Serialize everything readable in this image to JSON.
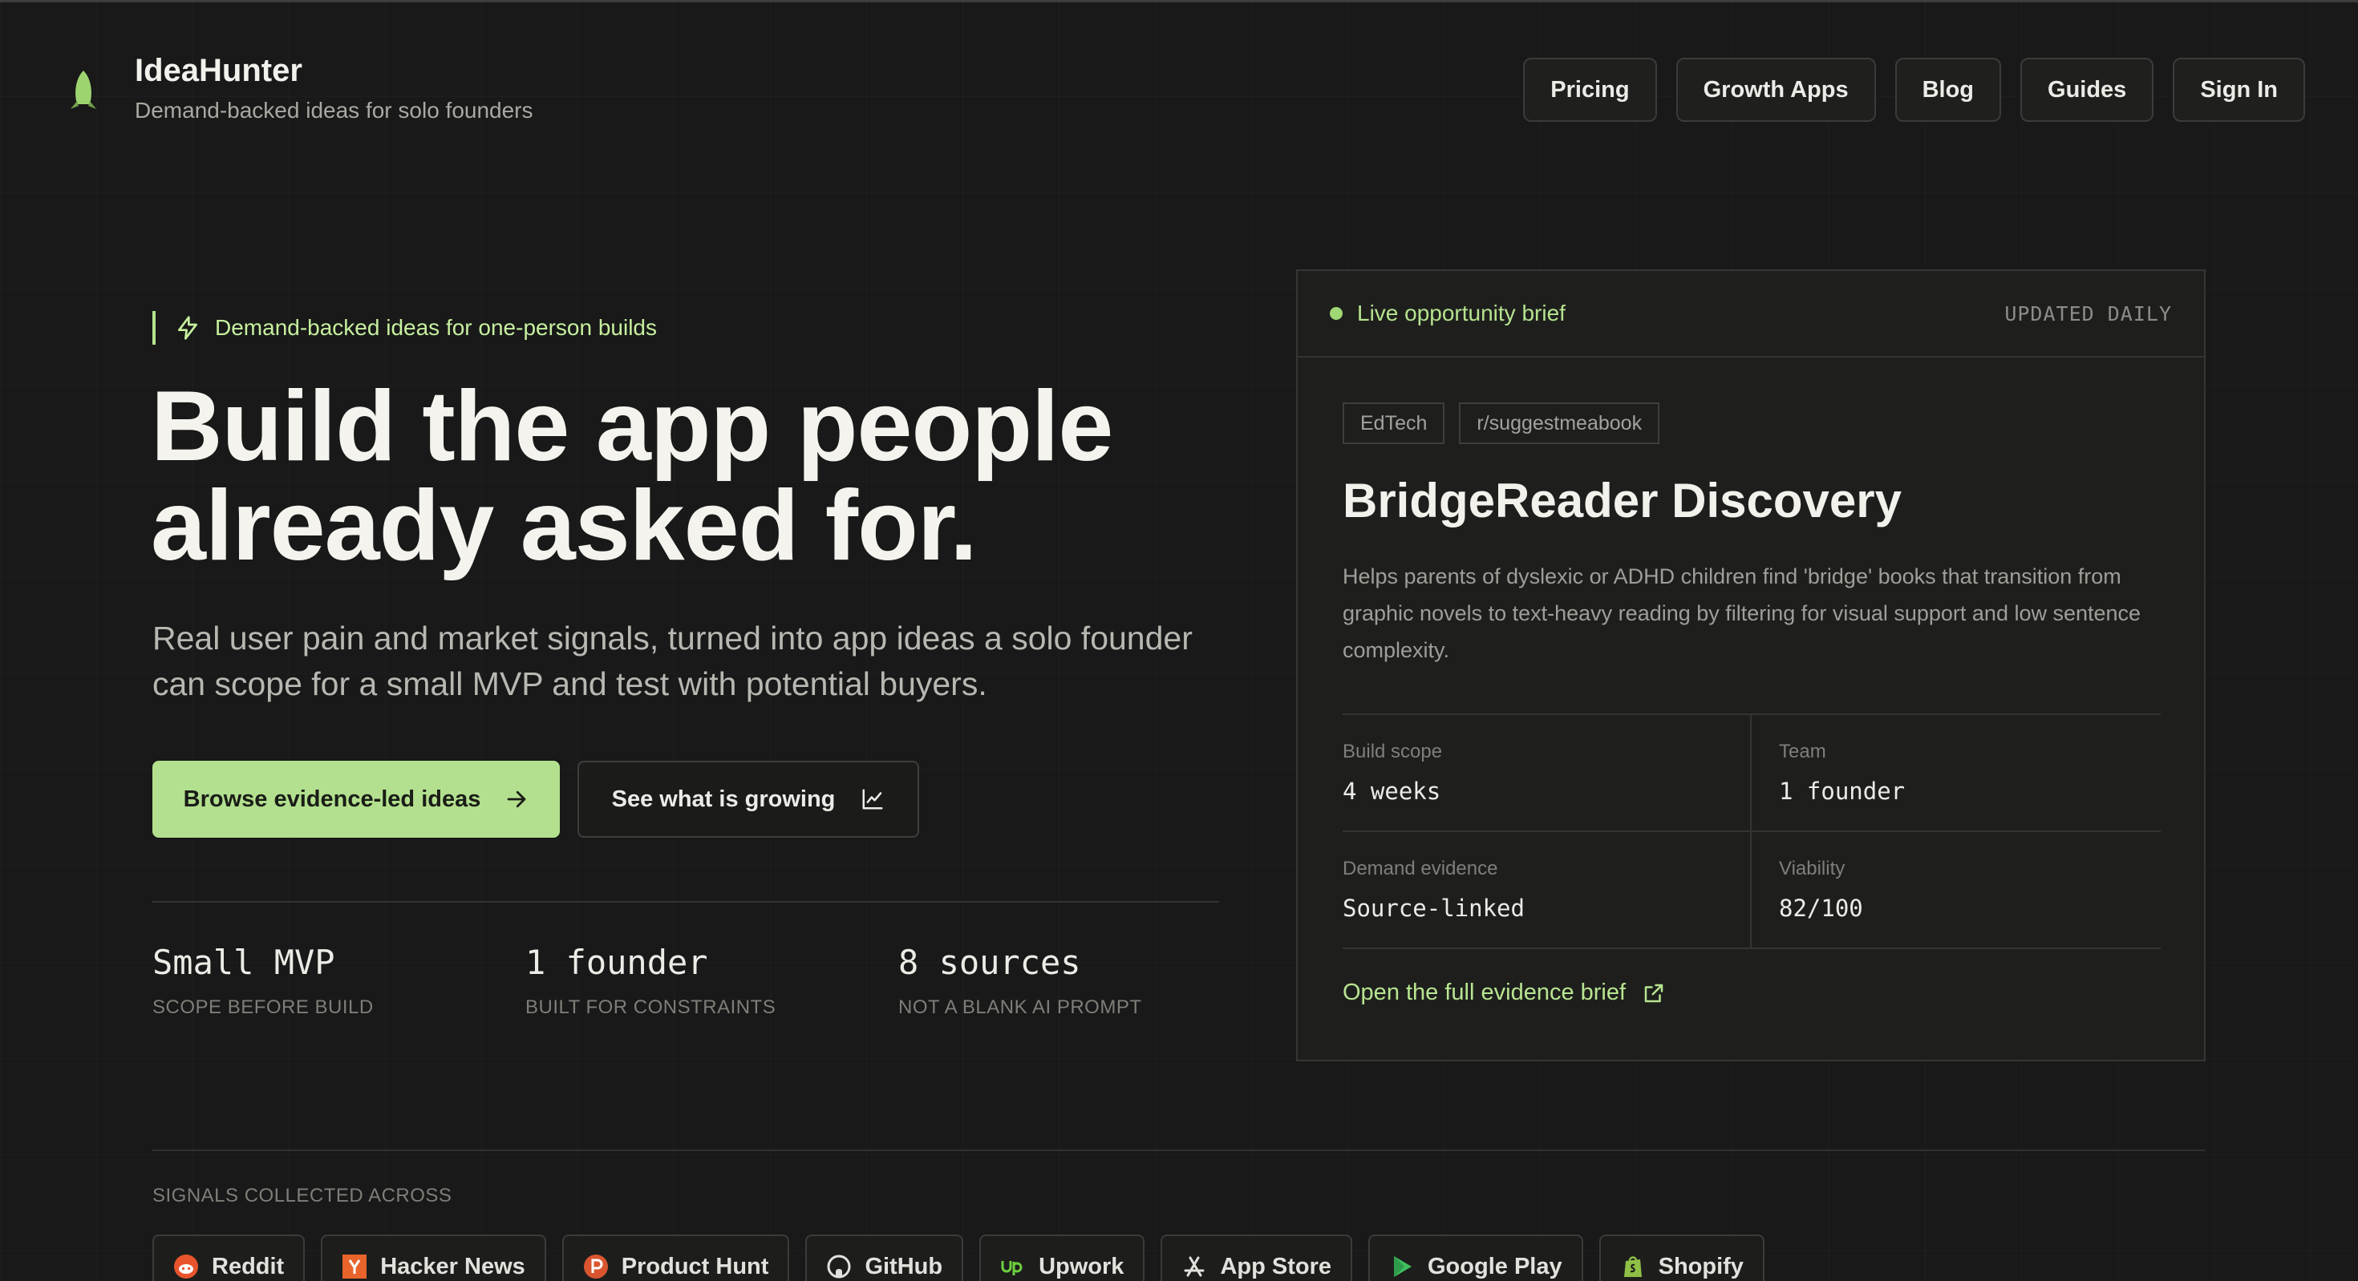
{
  "brand": {
    "name": "IdeaHunter",
    "tagline": "Demand-backed ideas for solo founders"
  },
  "nav": {
    "items": [
      "Pricing",
      "Growth Apps",
      "Blog",
      "Guides",
      "Sign In"
    ]
  },
  "hero": {
    "eyebrow": "Demand-backed ideas for one-person builds",
    "title_line1": "Build the app people",
    "title_line2": "already asked for.",
    "subtitle": "Real user pain and market signals, turned into app ideas a solo founder can scope for a small MVP and test with potential buyers.",
    "cta_primary": "Browse evidence-led ideas",
    "cta_secondary": "See what is growing",
    "stats": [
      {
        "value": "Small MVP",
        "label": "SCOPE BEFORE BUILD"
      },
      {
        "value": "1 founder",
        "label": "BUILT FOR CONSTRAINTS"
      },
      {
        "value": "8 sources",
        "label": "NOT A BLANK AI PROMPT"
      }
    ]
  },
  "brief": {
    "live_label": "Live opportunity brief",
    "updated_label": "UPDATED DAILY",
    "tags": [
      "EdTech",
      "r/suggestmeabook"
    ],
    "title": "BridgeReader Discovery",
    "description": "Helps parents of dyslexic or ADHD children find 'bridge' books that transition from graphic novels to text-heavy reading by filtering for visual support and low sentence complexity.",
    "metrics": [
      {
        "label": "Build scope",
        "value": "4 weeks"
      },
      {
        "label": "Team",
        "value": "1 founder"
      },
      {
        "label": "Demand evidence",
        "value": "Source-linked"
      },
      {
        "label": "Viability",
        "value": "82/100"
      }
    ],
    "link": "Open the full evidence brief"
  },
  "sources": {
    "label": "SIGNALS COLLECTED ACROSS",
    "items": [
      {
        "name": "Reddit",
        "icon": "reddit-icon",
        "color": "#e8542b"
      },
      {
        "name": "Hacker News",
        "icon": "hacker-news-icon",
        "color": "#e8642b"
      },
      {
        "name": "Product Hunt",
        "icon": "product-hunt-icon",
        "color": "#d9552f"
      },
      {
        "name": "GitHub",
        "icon": "github-icon",
        "color": "#e2e1dc"
      },
      {
        "name": "Upwork",
        "icon": "upwork-icon",
        "color": "#6fcf3f"
      },
      {
        "name": "App Store",
        "icon": "app-store-icon",
        "color": "#e2e1dc"
      },
      {
        "name": "Google Play",
        "icon": "google-play-icon",
        "color": "#3fbf5f"
      },
      {
        "name": "Shopify",
        "icon": "shopify-icon",
        "color": "#8fbf45"
      }
    ]
  },
  "colors": {
    "background": "#181918",
    "accent": "#b3e08e",
    "text": "#ecebe6"
  }
}
